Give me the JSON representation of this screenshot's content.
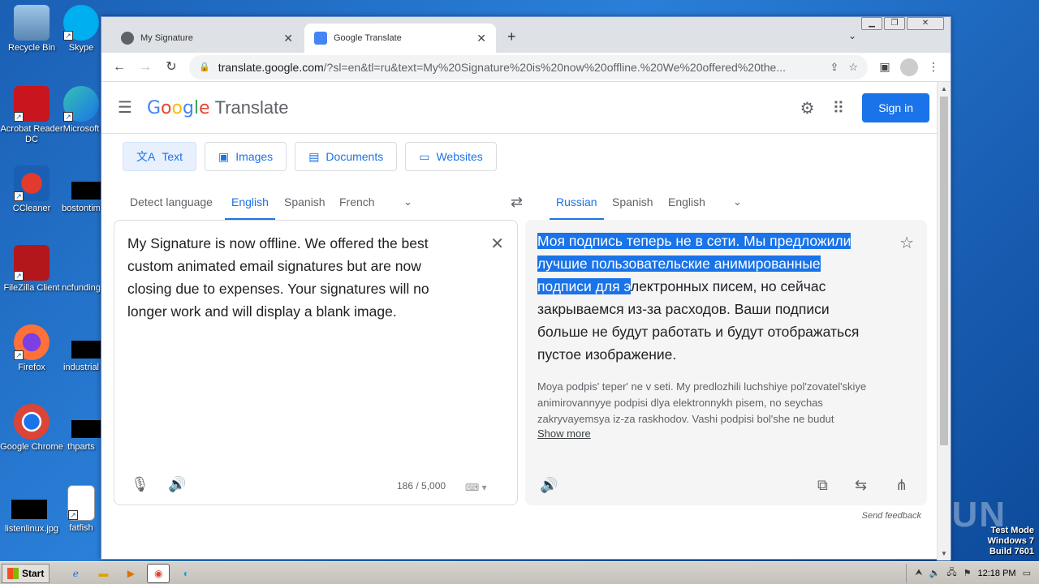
{
  "desktop": {
    "icons": [
      {
        "label": "Recycle Bin"
      },
      {
        "label": "Skype"
      },
      {
        "label": "Acrobat Reader DC"
      },
      {
        "label": "Microsoft"
      },
      {
        "label": "CCleaner"
      },
      {
        "label": "bostontim"
      },
      {
        "label": "FileZilla Client"
      },
      {
        "label": "ncfunding"
      },
      {
        "label": "Firefox"
      },
      {
        "label": "industrial"
      },
      {
        "label": "Google Chrome"
      },
      {
        "label": "thparts"
      },
      {
        "label": "listenlinux.jpg"
      },
      {
        "label": "fatfish"
      }
    ],
    "watermark": "ANY RUN",
    "test_mode": {
      "line1": "Test Mode",
      "line2": "Windows 7",
      "line3": "Build 7601"
    }
  },
  "browser": {
    "tabs": [
      {
        "title": "My Signature",
        "close": "✕"
      },
      {
        "title": "Google Translate",
        "close": "✕"
      }
    ],
    "new_tab": "+",
    "url_domain": "translate.google.com",
    "url_rest": "/?sl=en&tl=ru&text=My%20Signature%20is%20now%20offline.%20We%20offered%20the..."
  },
  "translate": {
    "product": "Translate",
    "signin": "Sign in",
    "modes": [
      "Text",
      "Images",
      "Documents",
      "Websites"
    ],
    "source_langs": [
      "Detect language",
      "English",
      "Spanish",
      "French"
    ],
    "target_langs": [
      "Russian",
      "Spanish",
      "English"
    ],
    "source_text": "My Signature is now offline. We offered the best custom animated email signatures but are now closing due to expenses. Your signatures will no longer work and will display a blank image.",
    "target_highlight": "Моя подпись теперь не в сети. Мы предложили лучшие пользовательские анимированные подписи для э",
    "target_rest": "лектронных писем, но сейчас закрываемся из-за расходов. Ваши подписи больше не будут работать и будут отображаться пустое изображение.",
    "transliteration": "Moya podpis' teper' ne v seti. My predlozhili luchshiye pol'zovatel'skiye animirovannyye podpisi dlya elektronnykh pisem, no seychas zakryvayemsya iz-za raskhodov. Vashi podpisi bol'she ne budut",
    "show_more": "Show more",
    "char_count": "186 / 5,000",
    "send_feedback": "Send feedback"
  },
  "taskbar": {
    "start": "Start",
    "clock": "12:18 PM"
  }
}
